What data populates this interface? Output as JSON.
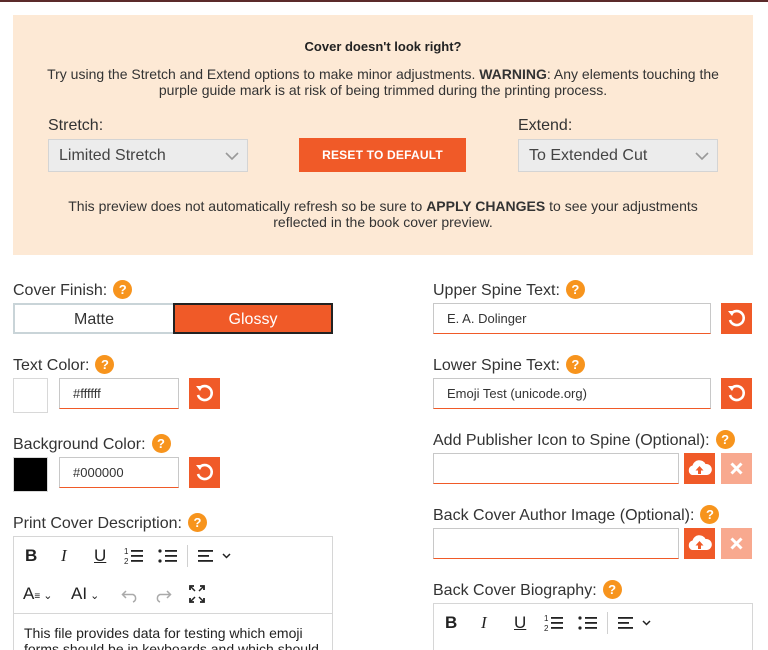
{
  "notice": {
    "title": "Cover doesn't look right?",
    "msg_prefix": "Try using the Stretch and Extend options to make minor adjustments. ",
    "msg_warning": "WARNING",
    "msg_suffix": ": Any elements touching the purple guide mark is at risk of being trimmed during the printing process.",
    "stretch_label": "Stretch:",
    "stretch_value": "Limited Stretch",
    "reset_label": "RESET TO DEFAULT",
    "extend_label": "Extend:",
    "extend_value": "To Extended Cut",
    "preview_prefix": "This preview does not automatically refresh so be sure to ",
    "preview_bold": "APPLY CHANGES",
    "preview_suffix": " to see your adjustments reflected in the book cover preview."
  },
  "left": {
    "cover_finish_label": "Cover Finish:",
    "finish_options": [
      "Matte",
      "Glossy"
    ],
    "finish_selected": "Glossy",
    "text_color_label": "Text Color:",
    "text_color_value": "#ffffff",
    "text_color_swatch": "#ffffff",
    "bg_color_label": "Background Color:",
    "bg_color_value": "#000000",
    "bg_color_swatch": "#000000",
    "print_desc_label": "Print Cover Description:",
    "desc_text": "This file provides data for testing which emoji forms should be in keyboards and which should"
  },
  "right": {
    "upper_spine_label": "Upper Spine Text:",
    "upper_spine_value": "E. A. Dolinger",
    "lower_spine_label": "Lower Spine Text:",
    "lower_spine_value": "Emoji Test (unicode.org)",
    "publisher_icon_label": "Add Publisher Icon to Spine (Optional):",
    "author_image_label": "Back Cover Author Image (Optional):",
    "biography_label": "Back Cover Biography:"
  },
  "editor_toolbar": {
    "bold": "B",
    "italic": "I",
    "underline": "U",
    "text_style": "A",
    "text_size": "AI"
  },
  "colors": {
    "accent": "#f05a28",
    "accent_light": "#f8a98f",
    "help": "#f7941d",
    "notice_bg": "#fde9d5"
  },
  "icons": [
    "help-icon",
    "undo-icon",
    "upload-cloud-icon",
    "close-icon",
    "chevron-down-icon",
    "bold-icon",
    "italic-icon",
    "underline-icon",
    "ordered-list-icon",
    "bullet-list-icon",
    "align-icon",
    "undo-arrow-icon",
    "redo-arrow-icon",
    "fullscreen-icon"
  ]
}
